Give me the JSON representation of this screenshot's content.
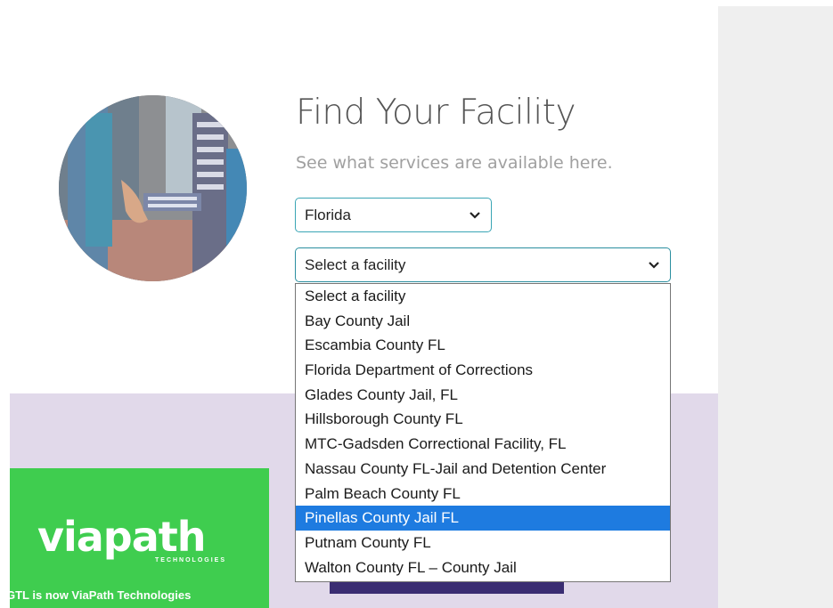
{
  "header": {
    "title": "Find Your Facility",
    "subtitle": "See what services are available here."
  },
  "state_select": {
    "value": "Florida"
  },
  "facility_select": {
    "value": "Select a facility",
    "options": [
      "Select a facility",
      "Bay County Jail",
      "Escambia County FL",
      "Florida Department of Corrections",
      "Glades County Jail, FL",
      "Hillsborough County FL",
      "MTC-Gadsden Correctional Facility, FL",
      "Nassau County FL-Jail and Detention Center",
      "Palm Beach County FL",
      "Pinellas County Jail FL",
      "Putnam County FL",
      "Walton County FL – County Jail"
    ],
    "highlighted": "Pinellas County Jail FL"
  },
  "promo": {
    "logo": "viapath",
    "logo_sub": "TECHNOLOGIES",
    "tagline": "GTL is now ViaPath Technologies"
  },
  "colors": {
    "accent": "#3aa5b5",
    "band": "#e1d9ea",
    "promo_green": "#3fcd4f",
    "highlight": "#1e7be0"
  }
}
